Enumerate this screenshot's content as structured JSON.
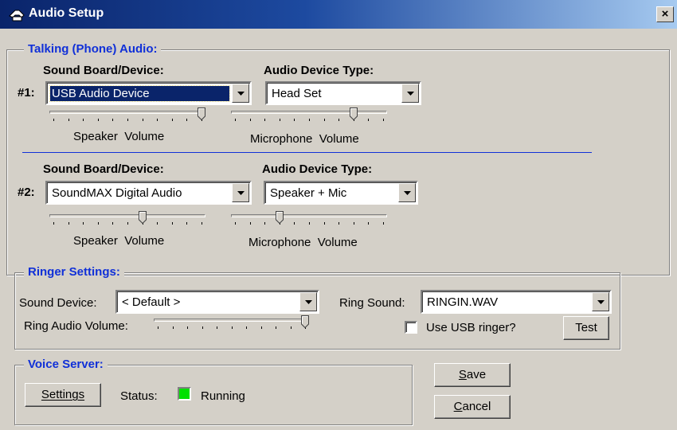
{
  "window": {
    "title": "Audio Setup",
    "close_label": "×"
  },
  "talking": {
    "legend": "Talking (Phone) Audio:",
    "devices": [
      {
        "index_label": "#1:",
        "sound_board_label": "Sound Board/Device:",
        "sound_board_value": "USB Audio Device",
        "device_type_label": "Audio Device Type:",
        "device_type_value": "Head Set",
        "speaker_label": "Speaker  Volume",
        "speaker_level": 1.0,
        "microphone_label": "Microphone  Volume",
        "microphone_level": 0.8
      },
      {
        "index_label": "#2:",
        "sound_board_label": "Sound Board/Device:",
        "sound_board_value": "SoundMAX Digital Audio",
        "device_type_label": "Audio Device Type:",
        "device_type_value": "Speaker + Mic",
        "speaker_label": "Speaker  Volume",
        "speaker_level": 0.6,
        "microphone_label": "Microphone  Volume",
        "microphone_level": 0.3
      }
    ]
  },
  "ringer": {
    "legend": "Ringer Settings:",
    "sound_device_label": "Sound Device:",
    "sound_device_value": "< Default >",
    "ring_sound_label": "Ring Sound:",
    "ring_sound_value": "RINGIN.WAV",
    "volume_label": "Ring Audio Volume:",
    "volume_level": 1.0,
    "usb_ringer_label": "Use USB ringer?",
    "usb_ringer_checked": false,
    "test_label": "Test"
  },
  "voice_server": {
    "legend": "Voice Server:",
    "settings_label": "Settings",
    "status_label": "Status:",
    "status_value": "Running",
    "status_color": "#00e000"
  },
  "actions": {
    "save_label": "Save",
    "cancel_label": "Cancel"
  },
  "icons": {
    "app": "phone-icon",
    "dropdown": "dropdown-arrow-icon",
    "close": "close-icon"
  }
}
